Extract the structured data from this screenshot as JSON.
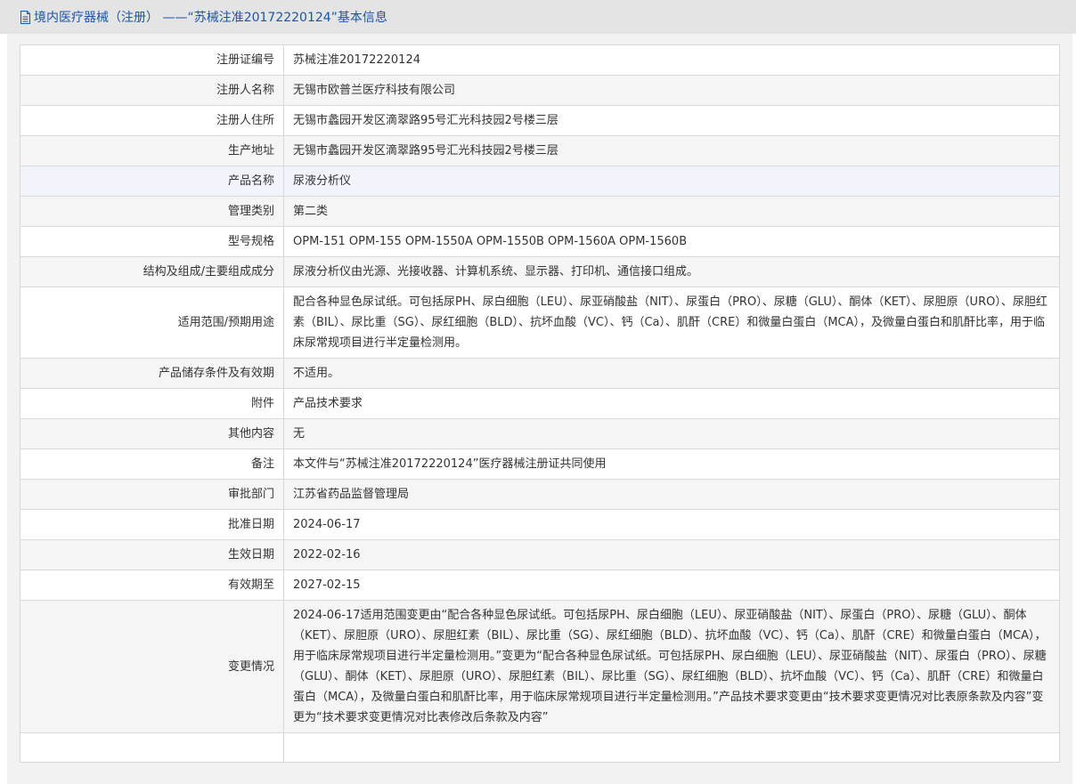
{
  "header": {
    "title": "境内医疗器械（注册） ——“苏械注准20172220124”基本信息",
    "icon": "document-icon",
    "color": "#1a55a6"
  },
  "rows": [
    {
      "label": "注册证编号",
      "value": "苏械注准20172220124"
    },
    {
      "label": "注册人名称",
      "value": "无锡市欧普兰医疗科技有限公司"
    },
    {
      "label": "注册人住所",
      "value": "无锡市蠡园开发区滴翠路95号汇光科技园2号楼三层"
    },
    {
      "label": "生产地址",
      "value": "无锡市蠡园开发区滴翠路95号汇光科技园2号楼三层"
    },
    {
      "label": "产品名称",
      "value": "尿液分析仪"
    },
    {
      "label": "管理类别",
      "value": "第二类"
    },
    {
      "label": "型号规格",
      "value": "OPM-151 OPM-155 OPM-1550A OPM-1550B OPM-1560A OPM-1560B"
    },
    {
      "label": "结构及组成/主要组成成分",
      "value": "尿液分析仪由光源、光接收器、计算机系统、显示器、打印机、通信接口组成。"
    },
    {
      "label": "适用范围/预期用途",
      "value": "配合各种显色尿试纸。可包括尿PH、尿白细胞（LEU）、尿亚硝酸盐（NIT）、尿蛋白（PRO）、尿糖（GLU）、酮体（KET）、尿胆原（URO）、尿胆红素（BIL）、尿比重（SG）、尿红细胞（BLD）、抗坏血酸（VC）、钙（Ca）、肌酐（CRE）和微量白蛋白（MCA），及微量白蛋白和肌酐比率，用于临床尿常规项目进行半定量检测用。"
    },
    {
      "label": "产品储存条件及有效期",
      "value": "不适用。"
    },
    {
      "label": "附件",
      "value": "产品技术要求"
    },
    {
      "label": "其他内容",
      "value": "无"
    },
    {
      "label": "备注",
      "value": "本文件与“苏械注准20172220124”医疗器械注册证共同使用"
    },
    {
      "label": "审批部门",
      "value": "江苏省药品监督管理局"
    },
    {
      "label": "批准日期",
      "value": "2024-06-17"
    },
    {
      "label": "生效日期",
      "value": "2022-02-16"
    },
    {
      "label": "有效期至",
      "value": "2027-02-15"
    },
    {
      "label": "变更情况",
      "value": "2024-06-17适用范围变更由“配合各种显色尿试纸。可包括尿PH、尿白细胞（LEU）、尿亚硝酸盐（NIT）、尿蛋白（PRO）、尿糖（GLU）、酮体（KET）、尿胆原（URO）、尿胆红素（BIL）、尿比重（SG）、尿红细胞（BLD）、抗坏血酸（VC）、钙（Ca）、肌酐（CRE）和微量白蛋白（MCA），用于临床尿常规项目进行半定量检测用。”变更为“配合各种显色尿试纸。可包括尿PH、尿白细胞（LEU）、尿亚硝酸盐（NIT）、尿蛋白（PRO）、尿糖（GLU）、酮体（KET）、尿胆原（URO）、尿胆红素（BIL）、尿比重（SG）、尿红细胞（BLD）、抗坏血酸（VC）、钙（Ca）、肌酐（CRE）和微量白蛋白（MCA），及微量白蛋白和肌酐比率，用于临床尿常规项目进行半定量检测用。”产品技术要求变更由“技术要求变更情况对比表原条款及内容”变更为“技术要求变更情况对比表修改后条款及内容”"
    },
    {
      "label": "",
      "value": ""
    }
  ]
}
